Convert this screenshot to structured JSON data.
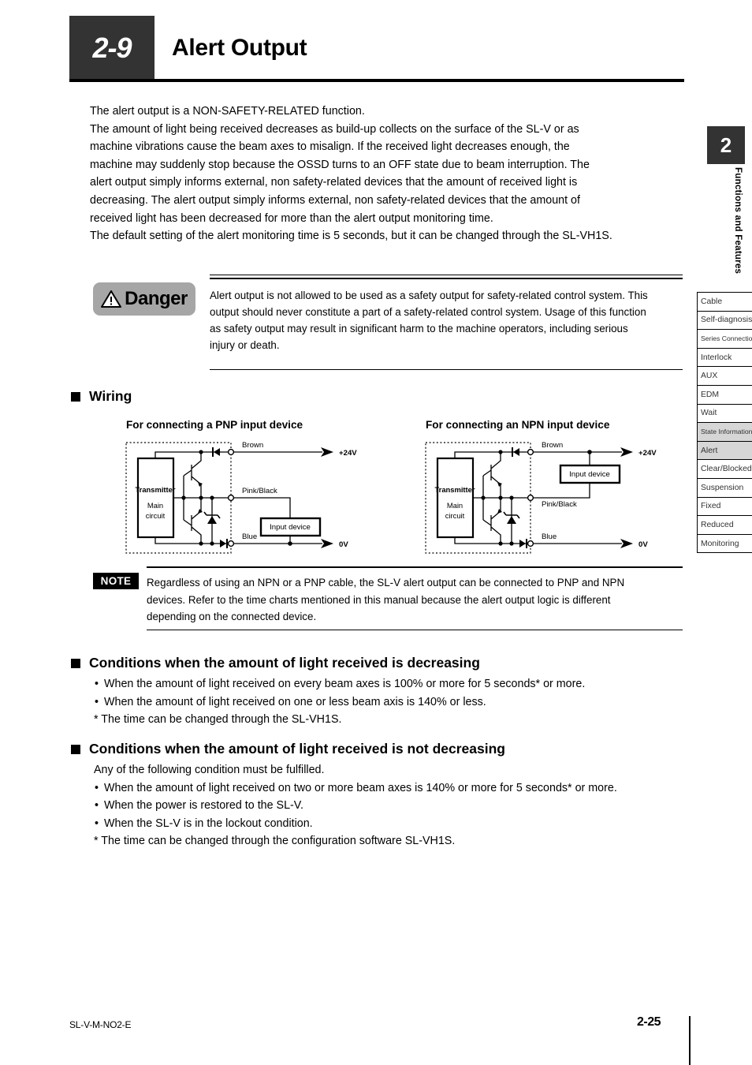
{
  "header": {
    "section_number": "2-9",
    "title": "Alert Output"
  },
  "intro": {
    "lines": [
      "The alert output is a NON-SAFETY-RELATED function.",
      "The amount of light being received decreases as build-up collects on the surface of the SL-V or as",
      "machine vibrations cause the beam axes to misalign.  If the received light decreases enough, the",
      "machine may suddenly stop because the OSSD turns to an OFF state due to beam interruption.  The",
      "alert output simply informs external, non safety-related devices that the amount of received light is",
      "decreasing.  The alert output simply informs external, non safety-related devices that the amount of",
      "received light has been decreased for more than the alert output monitoring time.",
      "The default setting of the alert monitoring time is 5 seconds, but it can be changed through the SL-VH1S."
    ]
  },
  "danger": {
    "badge_label": "Danger",
    "lines": [
      "Alert output is not allowed to be used as a safety output for safety-related control system. This",
      "output should never constitute a part of a safety-related control system. Usage of this function",
      "as safety output may result in significant harm to the machine operators, including serious",
      "injury or death."
    ]
  },
  "wiring": {
    "heading": "Wiring",
    "pnp": {
      "title": "For connecting a PNP input device",
      "block_label_1": "Transmitter",
      "block_label_2": "Main",
      "block_label_3": "circuit",
      "wire_brown": "Brown",
      "wire_pinkblack": "Pink/Black",
      "wire_blue": "Blue",
      "rail_plus": "+24V",
      "rail_zero": "0V",
      "input_device": "Input device"
    },
    "npn": {
      "title": "For connecting an NPN input device",
      "block_label_1": "Transmitter",
      "block_label_2": "Main",
      "block_label_3": "circuit",
      "wire_brown": "Brown",
      "wire_pinkblack": "Pink/Black",
      "wire_blue": "Blue",
      "rail_plus": "+24V",
      "rail_zero": "0V",
      "input_device": "Input device"
    }
  },
  "note": {
    "badge_label": "NOTE",
    "lines": [
      "Regardless of using an NPN or a PNP cable, the SL-V alert output can be connected to PNP and NPN",
      "devices. Refer to the time charts mentioned in this manual because the alert output logic is different",
      "depending on the connected device."
    ]
  },
  "conditions_decreasing": {
    "heading": "Conditions when the amount of light received is decreasing",
    "items": [
      "When the amount of light received on every beam axes is 100% or more for 5 seconds* or more.",
      "When the amount of light received on one or less beam axis is 140% or less."
    ],
    "footnote": "* The time can be changed through the SL-VH1S."
  },
  "conditions_not_decreasing": {
    "heading": "Conditions when the amount of light received is not decreasing",
    "intro": "Any of the following condition must be fulfilled.",
    "items": [
      "When the amount of light received on two or more beam axes is 140% or more for 5 seconds* or more.",
      "When the power is restored to the SL-V.",
      "When the SL-V is in the lockout condition."
    ],
    "footnote": "* The time can be changed through the configuration software SL-VH1S."
  },
  "sidebar": {
    "chapter_number": "2",
    "chapter_label": "Functions and Features",
    "items": [
      {
        "label": "Cable",
        "active": false,
        "small": false
      },
      {
        "label": "Self-diagnosis",
        "active": false,
        "small": false
      },
      {
        "label": "Series Connection",
        "active": false,
        "small": true
      },
      {
        "label": "Interlock",
        "active": false,
        "small": false
      },
      {
        "label": "AUX",
        "active": false,
        "small": false
      },
      {
        "label": "EDM",
        "active": false,
        "small": false
      },
      {
        "label": "Wait",
        "active": false,
        "small": false
      },
      {
        "label": "State Information",
        "active": true,
        "small": true
      },
      {
        "label": "Alert",
        "active": true,
        "small": false
      },
      {
        "label": "Clear/Blocked",
        "active": false,
        "small": false
      },
      {
        "label": "Suspension",
        "active": false,
        "small": false
      },
      {
        "label": "Fixed",
        "active": false,
        "small": false
      },
      {
        "label": "Reduced",
        "active": false,
        "small": false
      },
      {
        "label": "Monitoring",
        "active": false,
        "small": false
      }
    ]
  },
  "footer": {
    "document_code": "SL-V-M-NO2-E",
    "page_number": "2-25"
  },
  "colors": {
    "dark_block": "#333333",
    "danger_badge_bg": "#a6a6a6",
    "sidebar_active_bg": "#d6d6d6"
  }
}
